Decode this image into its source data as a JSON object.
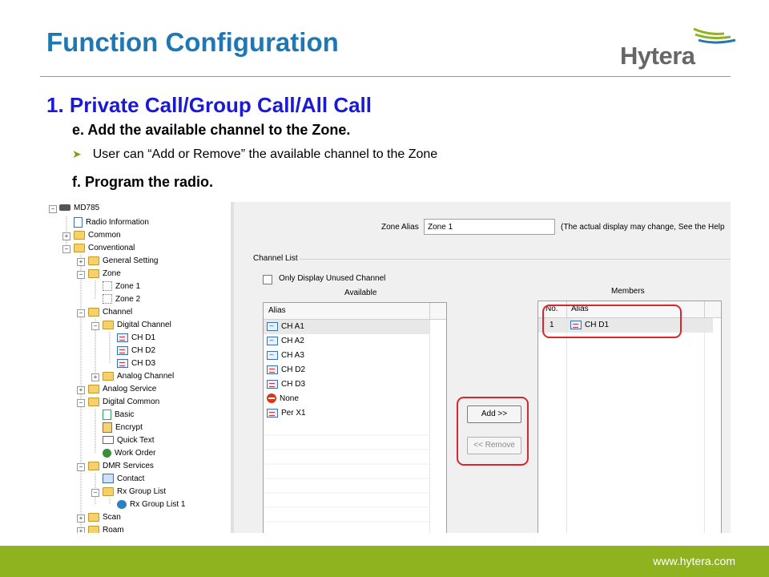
{
  "slide": {
    "title": "Function Configuration",
    "brand": "Hytera",
    "heading": "1. Private Call/Group Call/All Call",
    "step_e": "e. Add the available channel to the Zone.",
    "bullet": "User can “Add or Remove” the available channel to the Zone",
    "step_f": "f.  Program the radio.",
    "footer_url": "www.hytera.com"
  },
  "colors": {
    "title": "#1f78b4",
    "heading": "#1a1ad6",
    "accent_green": "#8fb21f",
    "highlight_red": "#d8262e"
  },
  "tree": {
    "items": [
      {
        "label": "MD785",
        "icon": "radio-icon"
      },
      {
        "label": "Radio Information",
        "icon": "document-icon"
      },
      {
        "label": "Common",
        "icon": "folder-icon"
      },
      {
        "label": "Conventional",
        "icon": "folder-icon"
      },
      {
        "label": "General Setting",
        "icon": "folder-icon"
      },
      {
        "label": "Zone",
        "icon": "folder-icon"
      },
      {
        "label": "Zone 1",
        "icon": "zone-icon"
      },
      {
        "label": "Zone 2",
        "icon": "zone-icon"
      },
      {
        "label": "Channel",
        "icon": "folder-icon"
      },
      {
        "label": "Digital Channel",
        "icon": "folder-icon"
      },
      {
        "label": "CH D1",
        "icon": "digital-channel-icon"
      },
      {
        "label": "CH D2",
        "icon": "digital-channel-icon"
      },
      {
        "label": "CH D3",
        "icon": "digital-channel-icon"
      },
      {
        "label": "Analog Channel",
        "icon": "folder-icon"
      },
      {
        "label": "Analog Service",
        "icon": "folder-icon"
      },
      {
        "label": "Digital Common",
        "icon": "folder-icon"
      },
      {
        "label": "Basic",
        "icon": "basic-icon"
      },
      {
        "label": "Encrypt",
        "icon": "encrypt-icon"
      },
      {
        "label": "Quick Text",
        "icon": "envelope-icon"
      },
      {
        "label": "Work Order",
        "icon": "work-order-icon"
      },
      {
        "label": "DMR Services",
        "icon": "folder-icon"
      },
      {
        "label": "Contact",
        "icon": "contact-icon"
      },
      {
        "label": "Rx Group List",
        "icon": "folder-icon"
      },
      {
        "label": "Rx Group List 1",
        "icon": "group-icon"
      },
      {
        "label": "Scan",
        "icon": "folder-icon"
      },
      {
        "label": "Roam",
        "icon": "folder-icon"
      }
    ]
  },
  "zone": {
    "alias_label": "Zone Alias",
    "alias_value": "Zone 1",
    "alias_note": "(The actual display may change, See the Help"
  },
  "channel_list": {
    "group_label": "Channel List",
    "unused_checkbox_label": "Only Display Unused Channel",
    "available_label": "Available",
    "members_label": "Members",
    "available_header": "Alias",
    "available": [
      {
        "label": "CH A1",
        "icon": "analog-channel-icon"
      },
      {
        "label": "CH A2",
        "icon": "analog-channel-icon"
      },
      {
        "label": "CH A3",
        "icon": "analog-channel-icon"
      },
      {
        "label": "CH D2",
        "icon": "digital-channel-icon"
      },
      {
        "label": "CH D3",
        "icon": "digital-channel-icon"
      },
      {
        "label": "None",
        "icon": "none-icon"
      },
      {
        "label": "Per X1",
        "icon": "digital-channel-icon"
      }
    ],
    "members_headers": {
      "no": "No.",
      "alias": "Alias"
    },
    "members": [
      {
        "no": "1",
        "alias": "CH D1",
        "icon": "digital-channel-icon"
      }
    ],
    "add_button": "Add >>",
    "remove_button": "<< Remove"
  }
}
